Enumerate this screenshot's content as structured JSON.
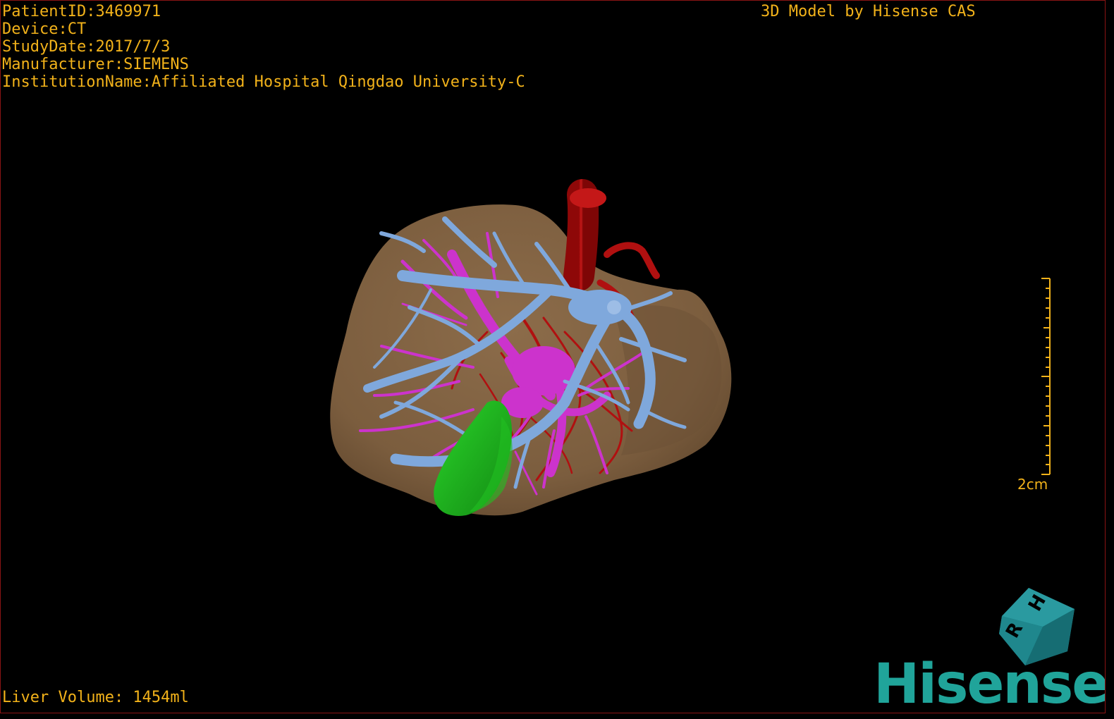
{
  "overlay": {
    "patient_id": "PatientID:3469971",
    "device": "Device:CT",
    "study_date": "StudyDate:2017/7/3",
    "manufacturer": "Manufacturer:SIEMENS",
    "institution": "InstitutionName:Affiliated Hospital Qingdao University-C",
    "model_credit": "3D Model by Hisense CAS",
    "liver_volume": "Liver Volume: 1454ml"
  },
  "scale": {
    "label": "2cm"
  },
  "orientation_cube": {
    "face_top": "H",
    "face_left": "R"
  },
  "brand": {
    "name": "Hisense"
  },
  "colors": {
    "text": "#f2b21a",
    "liver": "#7b5d3e",
    "portal_vein": "#7fa8dc",
    "hepatic_vein": "#cc33cc",
    "artery": "#b01010",
    "gallbladder": "#1fb51f",
    "brand": "#20a49a",
    "border": "#8a1414"
  },
  "structures": [
    "liver",
    "portal-vein",
    "hepatic-vein",
    "hepatic-artery",
    "gallbladder"
  ]
}
